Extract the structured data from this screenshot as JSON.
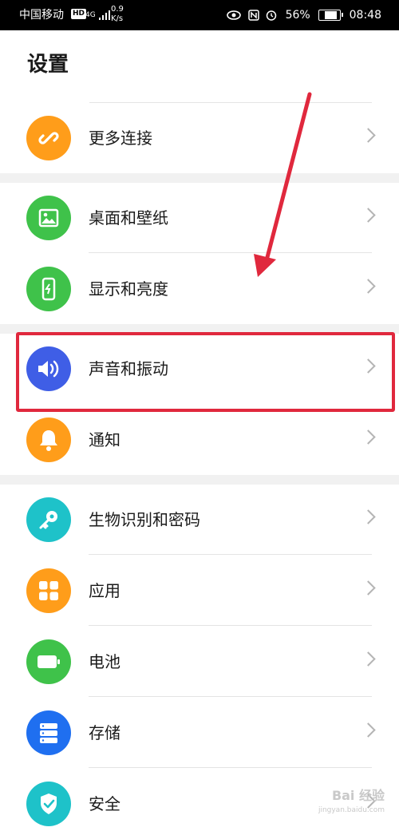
{
  "status_bar": {
    "carrier": "中国移动",
    "hd": "HD",
    "network": "4G",
    "speed_value": "0.9",
    "speed_unit": "K/s",
    "battery_percent": "56%",
    "battery_level": 0.56,
    "time": "08:48"
  },
  "page": {
    "title": "设置"
  },
  "settings_items": [
    {
      "id": "more-connections",
      "label": "更多连接",
      "icon": "link-icon",
      "color": "#ff9d1a"
    },
    {
      "id": "wallpaper",
      "label": "桌面和壁纸",
      "icon": "image-icon",
      "color": "#3fc24a"
    },
    {
      "id": "display",
      "label": "显示和亮度",
      "icon": "phone-brightness-icon",
      "color": "#3fc24a"
    },
    {
      "id": "sound",
      "label": "声音和振动",
      "icon": "speaker-icon",
      "color": "#3f5ee6"
    },
    {
      "id": "notifications",
      "label": "通知",
      "icon": "bell-icon",
      "color": "#ff9d1a"
    },
    {
      "id": "biometrics",
      "label": "生物识别和密码",
      "icon": "key-icon",
      "color": "#1ec2c9"
    },
    {
      "id": "apps",
      "label": "应用",
      "icon": "apps-grid-icon",
      "color": "#ff9d1a"
    },
    {
      "id": "battery",
      "label": "电池",
      "icon": "battery-icon",
      "color": "#3fc24a"
    },
    {
      "id": "storage",
      "label": "存储",
      "icon": "storage-icon",
      "color": "#1f6ff0"
    },
    {
      "id": "security",
      "label": "安全",
      "icon": "shield-icon",
      "color": "#1ec2c9"
    }
  ],
  "annotation": {
    "highlight_color": "#e0283d"
  },
  "watermark": {
    "text": "Bai 经验",
    "subtext": "jingyan.baidu.com"
  }
}
